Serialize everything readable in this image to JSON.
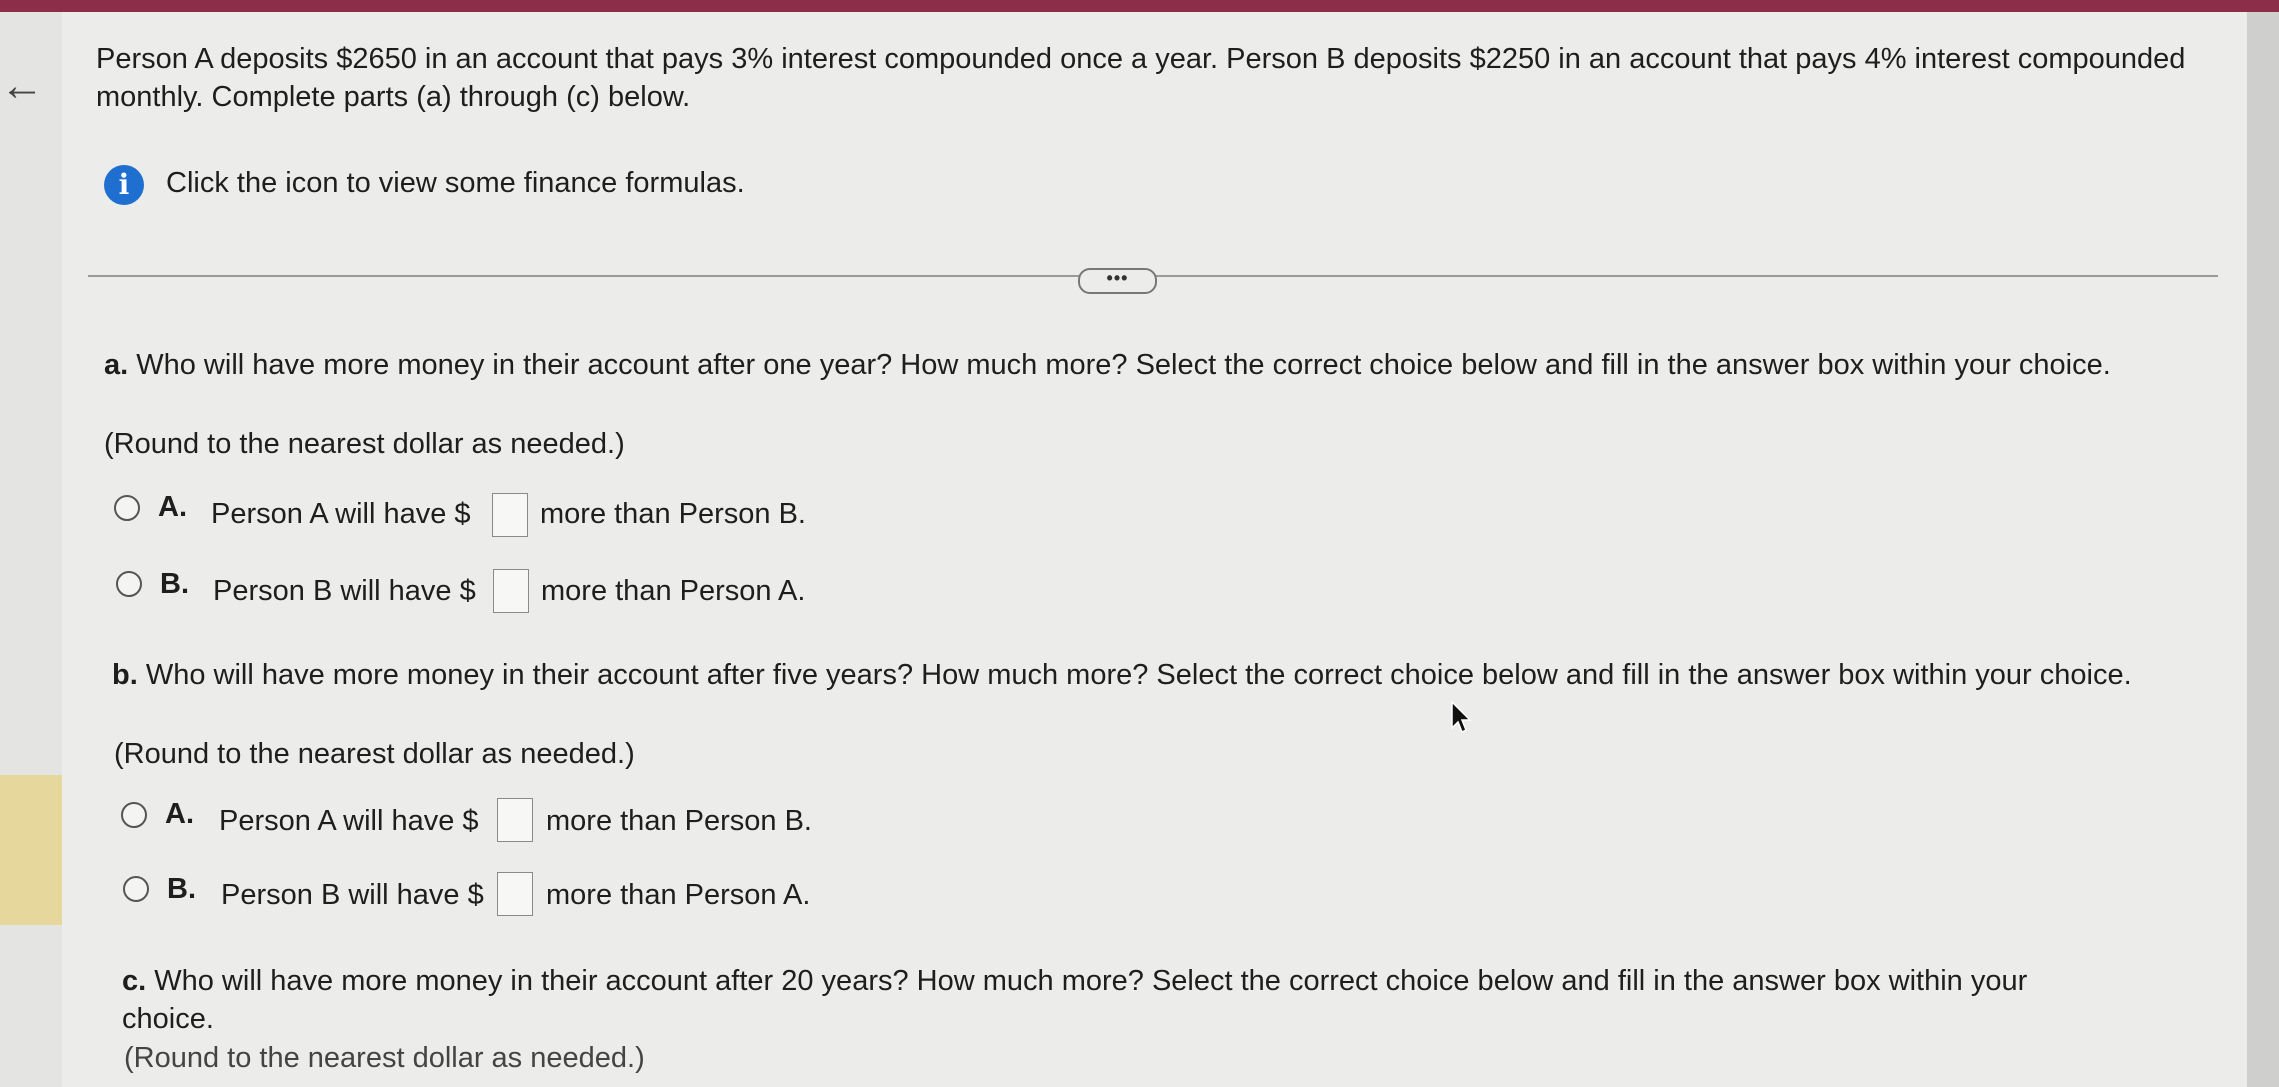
{
  "problem": {
    "text": "Person A deposits $2650 in an account that pays 3% interest compounded once a year. Person B deposits $2250 in an account that pays 4% interest compounded monthly. Complete parts (a) through (c) below."
  },
  "info": {
    "icon": "info-icon",
    "text": "Click the icon to view some finance formulas."
  },
  "more_button": {
    "label": "•••"
  },
  "part_a": {
    "label": "a.",
    "question": "Who will have more money in their account after one year? How much more? Select the correct choice below and fill in the answer box within your choice.",
    "round_note": "(Round to the nearest dollar as needed.)",
    "options": [
      {
        "letter": "A.",
        "prefix": "Person A will have $",
        "suffix": "more than Person B."
      },
      {
        "letter": "B.",
        "prefix": "Person B will have $",
        "suffix": "more than Person A."
      }
    ]
  },
  "part_b": {
    "label": "b.",
    "question": "Who will have more money in their account after five years? How much more? Select the correct choice below and fill in the answer box within your choice.",
    "round_note": "(Round to the nearest dollar as needed.)",
    "options": [
      {
        "letter": "A.",
        "prefix": "Person A will have $",
        "suffix": "more than Person B."
      },
      {
        "letter": "B.",
        "prefix": "Person B will have $",
        "suffix": "more than Person A."
      }
    ]
  },
  "part_c": {
    "label": "c.",
    "question": "Who will have more money in their account after 20 years? How much more? Select the correct choice below and fill in the answer box within your choice.",
    "round_note": "(Round to the nearest dollar as needed.)"
  },
  "colors": {
    "info_blue": "#1f6fd0",
    "top_bar": "#8c2e4a",
    "panel_bg": "#ececea"
  }
}
